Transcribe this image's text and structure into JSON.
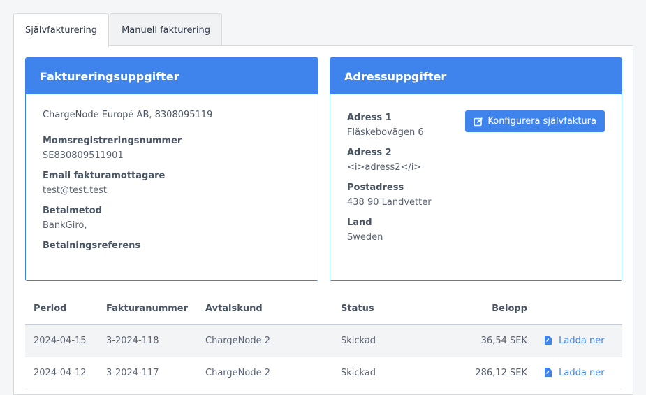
{
  "tabs": [
    "Självfakturering",
    "Manuell fakturering"
  ],
  "billing": {
    "title": "Faktureringsuppgifter",
    "company": "ChargeNode Europé AB, 8308095119",
    "fields": [
      {
        "label": "Momsregistreringsnummer",
        "value": "SE830809511901"
      },
      {
        "label": "Email fakturamottagare",
        "value": "test@test.test"
      },
      {
        "label": "Betalmetod",
        "value": "BankGiro,"
      },
      {
        "label": "Betalningsreferens",
        "value": ""
      }
    ]
  },
  "address": {
    "title": "Adressuppgifter",
    "configure_button": "Konfigurera självfaktura",
    "fields": [
      {
        "label": "Adress 1",
        "value": "Fläskebovägen 6"
      },
      {
        "label": "Adress 2",
        "value": "<i>adress2</i>"
      },
      {
        "label": "Postadress",
        "value": "438 90 Landvetter"
      },
      {
        "label": "Land",
        "value": "Sweden"
      }
    ]
  },
  "table": {
    "headers": [
      "Period",
      "Fakturanummer",
      "Avtalskund",
      "Status",
      "Belopp",
      ""
    ],
    "rows": [
      {
        "period": "2024-04-15",
        "number": "3-2024-118",
        "customer": "ChargeNode 2",
        "status": "Skickad",
        "amount": "36,54 SEK",
        "action": "Ladda ner"
      },
      {
        "period": "2024-04-12",
        "number": "3-2024-117",
        "customer": "ChargeNode 2",
        "status": "Skickad",
        "amount": "286,12 SEK",
        "action": "Ladda ner"
      }
    ]
  },
  "colors": {
    "accent": "#3f84ec"
  },
  "icons": {
    "configure": "edit-icon",
    "download": "pdf-file-icon"
  }
}
